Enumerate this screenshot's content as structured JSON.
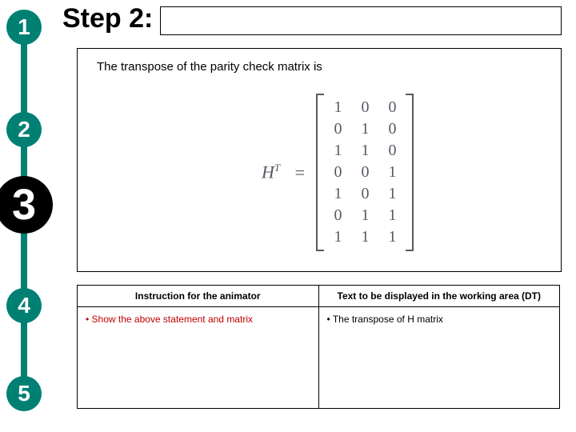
{
  "timeline": {
    "s1": "1",
    "s2": "2",
    "s3": "3",
    "s4": "4",
    "s5": "5"
  },
  "title": "Step 2:",
  "content_text": "The transpose of the parity check matrix is",
  "matrix": {
    "symbol": "H",
    "exp": "T",
    "eq": "=",
    "rows": [
      [
        "1",
        "0",
        "0"
      ],
      [
        "0",
        "1",
        "0"
      ],
      [
        "1",
        "1",
        "0"
      ],
      [
        "0",
        "0",
        "1"
      ],
      [
        "1",
        "0",
        "1"
      ],
      [
        "0",
        "1",
        "1"
      ],
      [
        "1",
        "1",
        "1"
      ]
    ]
  },
  "itable": {
    "h1": "Instruction for the animator",
    "h2": "Text to be displayed in the working area (DT)",
    "c1": "• Show the above statement and matrix",
    "c2": "• The transpose of H matrix"
  }
}
